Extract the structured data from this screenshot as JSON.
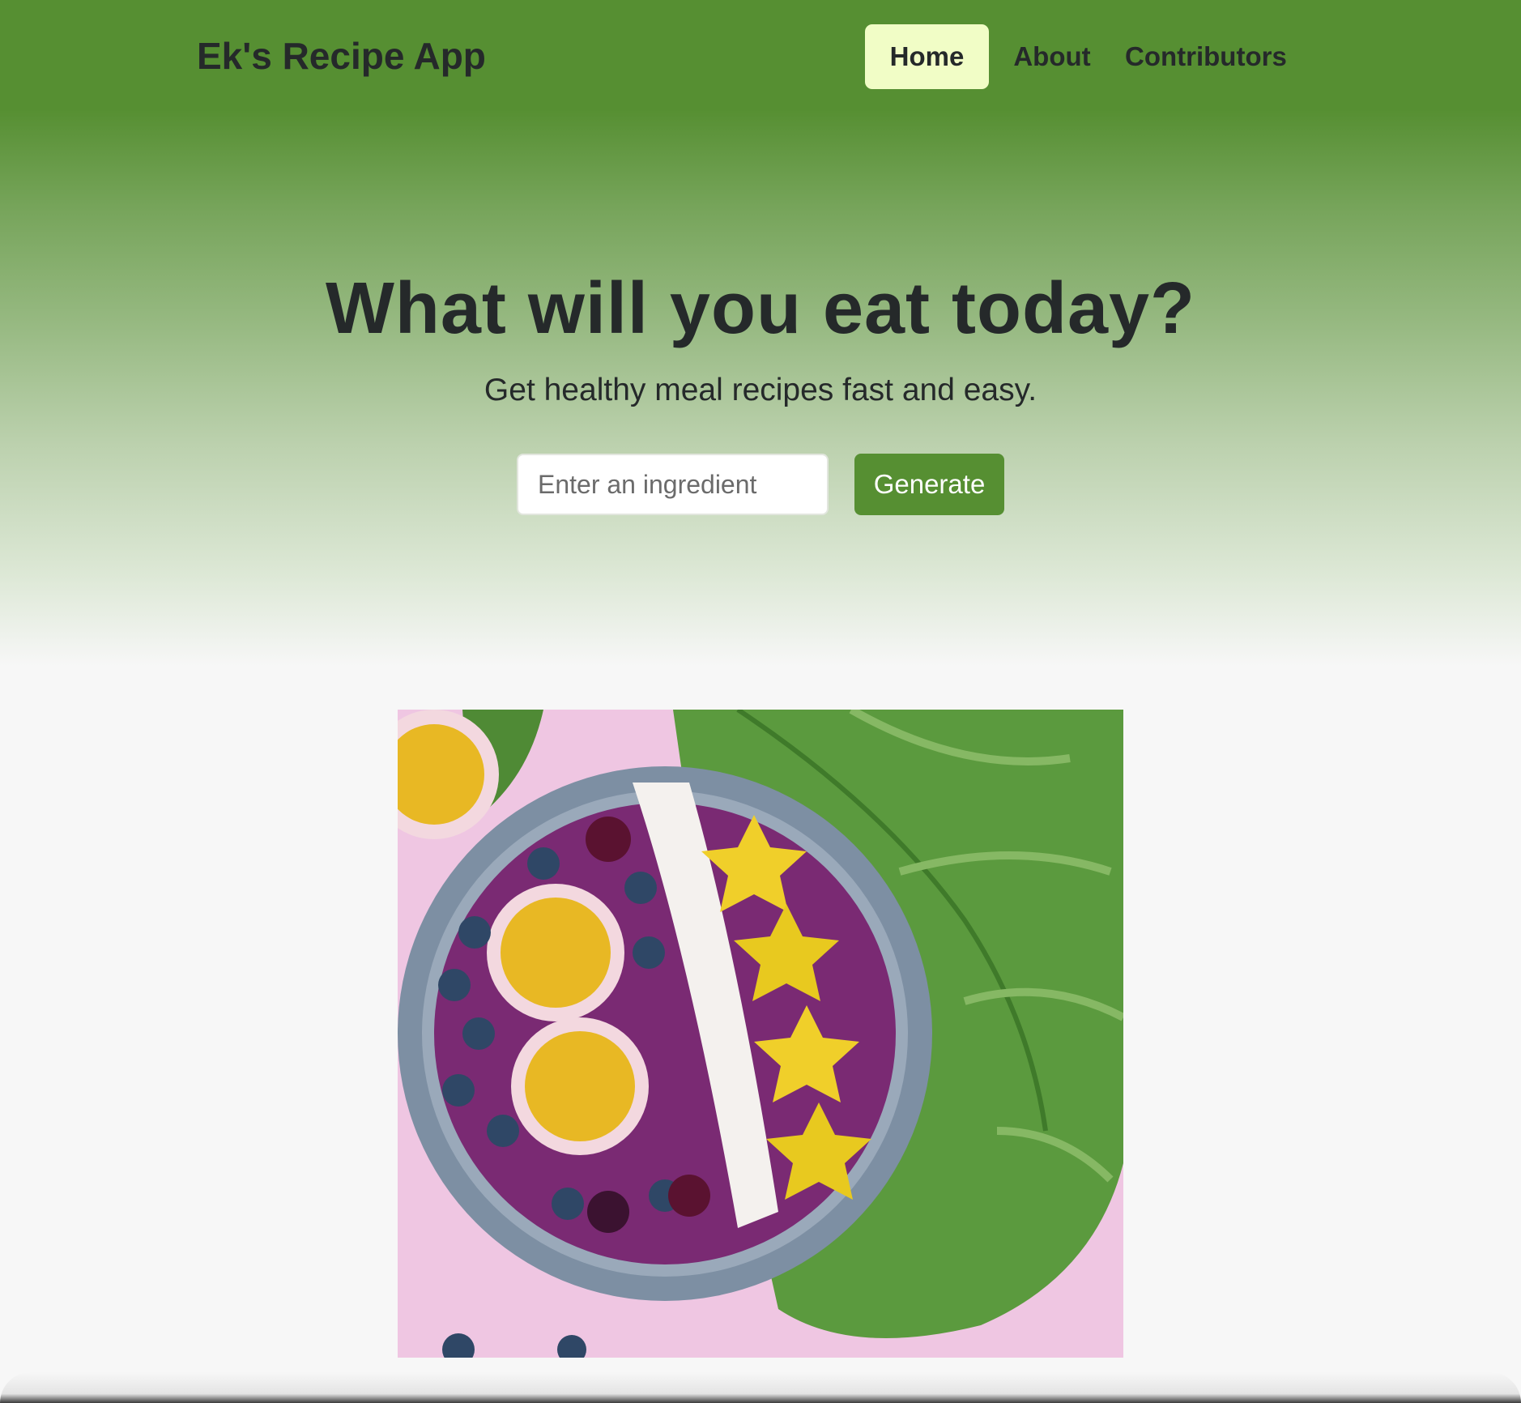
{
  "navbar": {
    "brand": "Ek's Recipe App",
    "links": [
      {
        "label": "Home",
        "active": true
      },
      {
        "label": "About",
        "active": false
      },
      {
        "label": "Contributors",
        "active": false
      }
    ]
  },
  "hero": {
    "headline": "What will you eat today?",
    "subheadline": "Get healthy meal recipes fast and easy."
  },
  "search": {
    "placeholder": "Enter an ingredient",
    "value": "",
    "button_label": "Generate"
  },
  "image": {
    "subject": "smoothie-bowl-photo"
  },
  "colors": {
    "primary_green": "#568f32",
    "active_nav_bg": "#f1fdc6",
    "text_dark": "#25292a",
    "page_bg": "#f7f7f7"
  }
}
